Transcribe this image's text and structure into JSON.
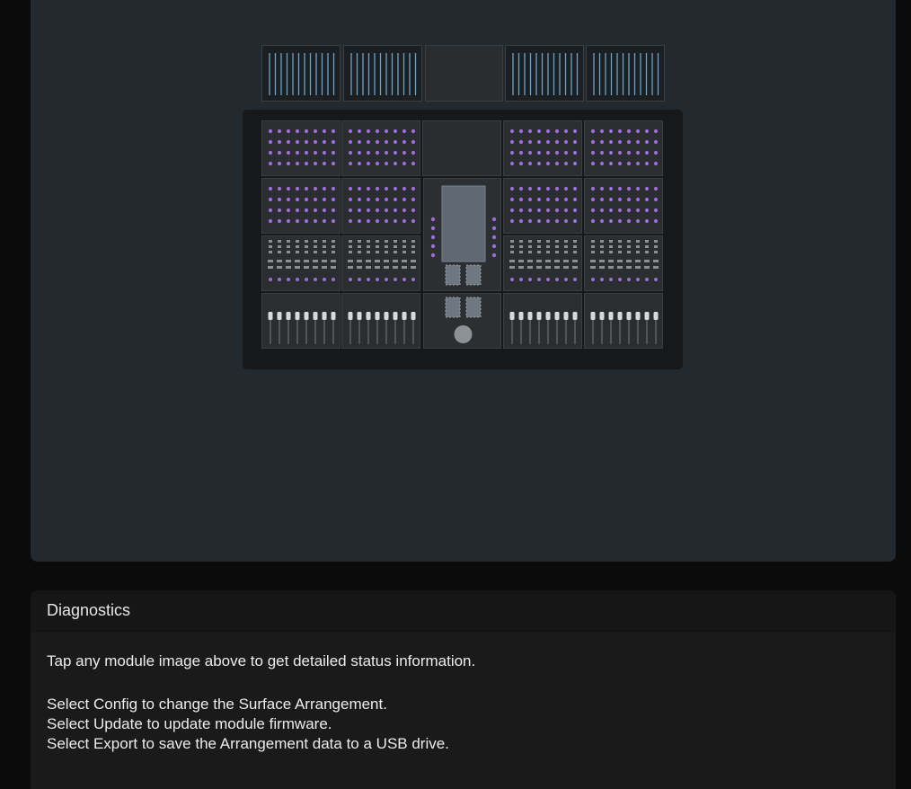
{
  "surface": {
    "meter_bridge": [
      "meter-module",
      "meter-module",
      "blank-module",
      "meter-module",
      "meter-module"
    ],
    "colors": {
      "panel": "#222a2f",
      "meter_line": "#6aa3c9",
      "button_led": "#9b6dd6",
      "fader_cap": "#d9d9d9",
      "display": "#5f6870"
    }
  },
  "diagnostics": {
    "title": "Diagnostics",
    "lines": [
      "Tap any module image above to get detailed status information.",
      "Select Config to change the Surface Arrangement.",
      "Select Update to update module firmware.",
      "Select Export to save the Arrangement data to a USB drive."
    ]
  }
}
